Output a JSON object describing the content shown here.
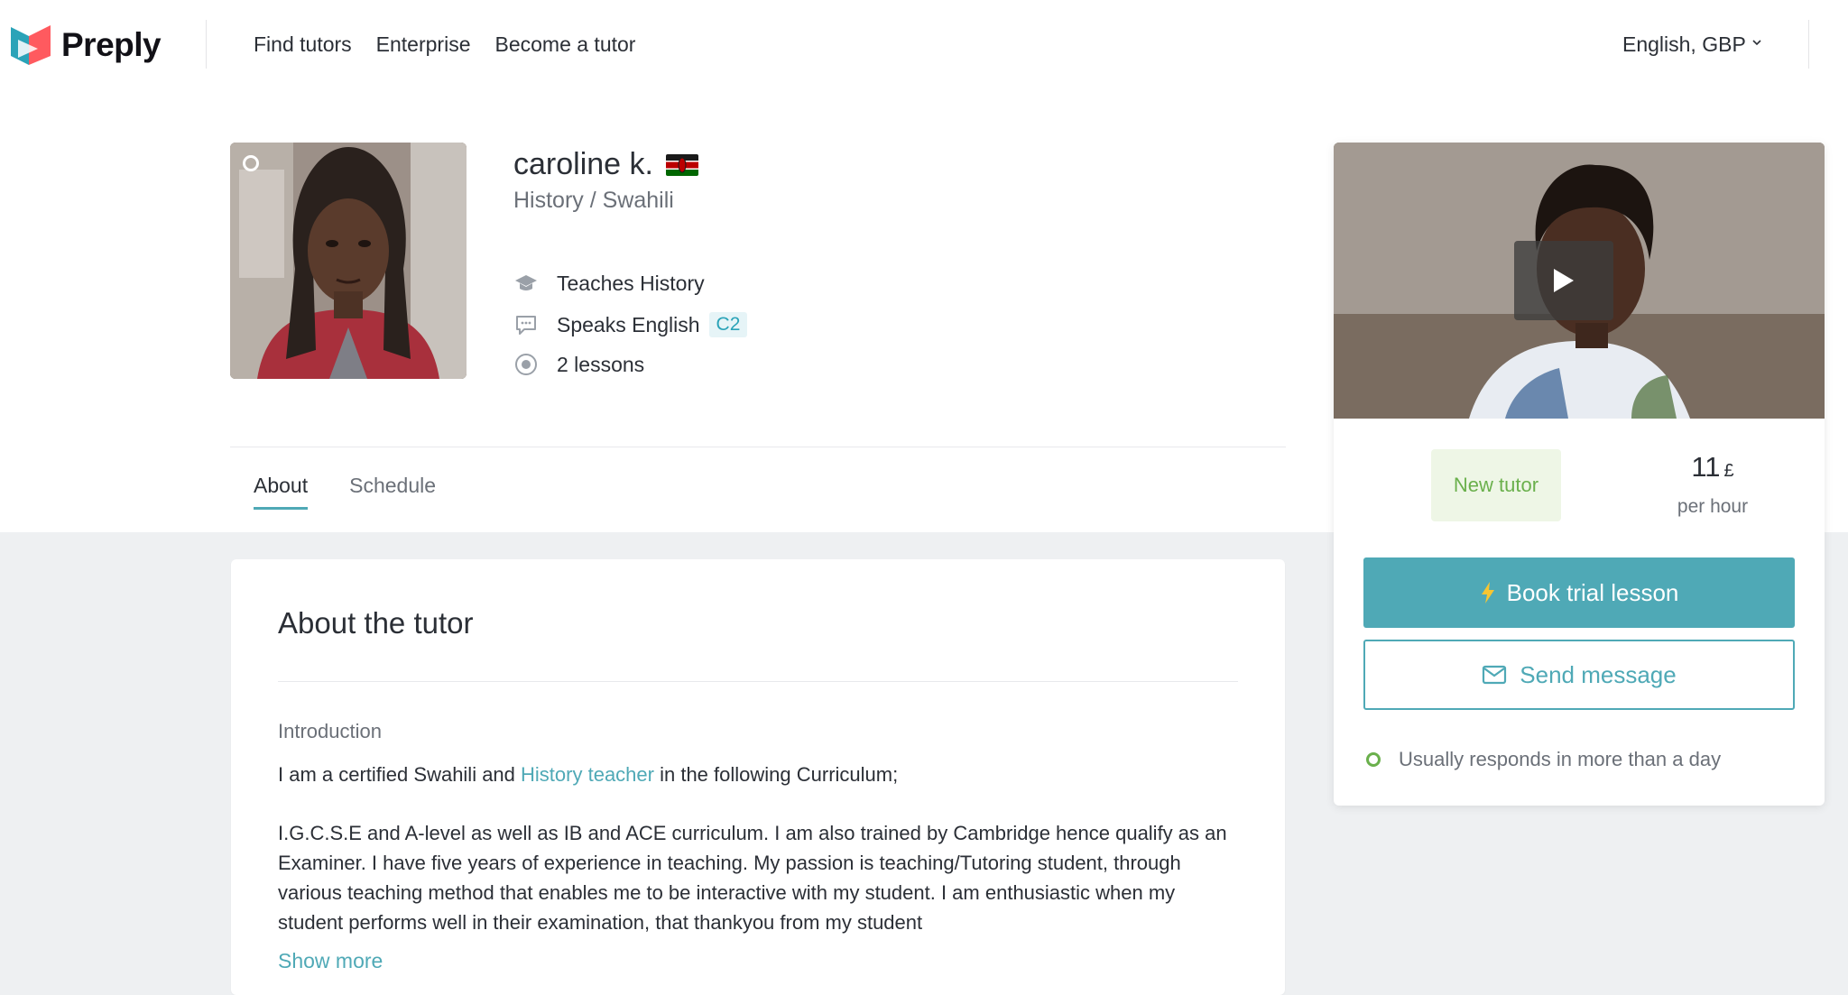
{
  "header": {
    "logo_text": "Preply",
    "nav": [
      "Find tutors",
      "Enterprise",
      "Become a tutor"
    ],
    "locale": "English, GBP"
  },
  "tutor": {
    "name": "caroline k.",
    "country_flag": "kenya-flag-icon",
    "subjects": "History / Swahili",
    "teaches_label": "Teaches",
    "teaches_value": "History",
    "speaks_label": "Speaks",
    "speaks_value": "English",
    "speaks_level": "C2",
    "lessons": "2 lessons"
  },
  "tabs": [
    "About",
    "Schedule"
  ],
  "about": {
    "title": "About the tutor",
    "intro_label": "Introduction",
    "intro_before": "I am a certified Swahili and ",
    "intro_link": "History teacher",
    "intro_after": " in the following Curriculum;",
    "intro_para2": "I.G.C.S.E and A-level as well as IB and ACE curriculum. I am also trained by Cambridge hence qualify as an Examiner. I have five years of experience in teaching. My passion is teaching/Tutoring student, through various teaching method that enables me to be interactive with my student. I am enthusiastic when my student performs well in their examination, that thankyou from my student",
    "show_more": "Show more"
  },
  "booking": {
    "badge": "New tutor",
    "price_amount": "11",
    "price_currency": "£",
    "price_unit": "per hour",
    "book_label": "Book trial lesson",
    "message_label": "Send message",
    "responds": "Usually responds in more than a day"
  },
  "colors": {
    "accent": "#4fa9b6",
    "new_tutor_green": "#6ab04c",
    "page_gray": "#eef0f2"
  }
}
